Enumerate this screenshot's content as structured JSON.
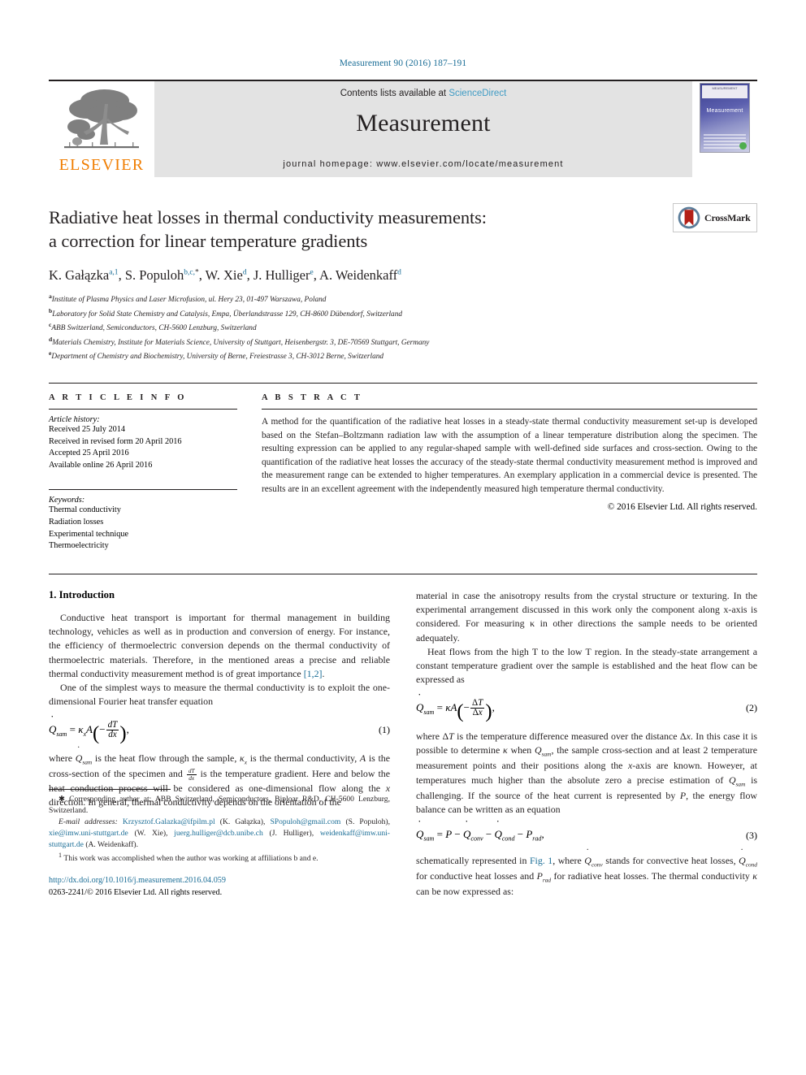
{
  "running_head": "Measurement 90 (2016) 187–191",
  "masthead": {
    "publisher_word": "ELSEVIER",
    "contents_prefix": "Contents lists available at ",
    "contents_link": "ScienceDirect",
    "journal_name": "Measurement",
    "homepage": "journal homepage: www.elsevier.com/locate/measurement",
    "cover_top_text": "MEASUREMENT",
    "cover_title": "Measurement"
  },
  "article": {
    "title_line1": "Radiative heat losses in thermal conductivity measurements:",
    "title_line2": "a correction for linear temperature gradients",
    "crossmark_label": "CrossMark",
    "authors": [
      {
        "name": "K. Gałązka",
        "marks": "a,1"
      },
      {
        "name": "S. Populoh",
        "marks": "b,c,"
      },
      {
        "name": "W. Xie",
        "marks": "d"
      },
      {
        "name": "J. Hulliger",
        "marks": "e"
      },
      {
        "name": "A. Weidenkaff",
        "marks": "d"
      }
    ],
    "affiliations": [
      {
        "mark": "a",
        "text": "Institute of Plasma Physics and Laser Microfusion, ul. Hery 23, 01-497 Warszawa, Poland"
      },
      {
        "mark": "b",
        "text": "Laboratory for Solid State Chemistry and Catalysis, Empa, Überlandstrasse 129, CH-8600 Dübendorf, Switzerland"
      },
      {
        "mark": "c",
        "text": "ABB Switzerland, Semiconductors, CH-5600 Lenzburg, Switzerland"
      },
      {
        "mark": "d",
        "text": "Materials Chemistry, Institute for Materials Science, University of Stuttgart, Heisenbergstr. 3, DE-70569 Stuttgart, Germany"
      },
      {
        "mark": "e",
        "text": "Department of Chemistry and Biochemistry, University of Berne, Freiestrasse 3, CH-3012 Berne, Switzerland"
      }
    ]
  },
  "article_info": {
    "heading": "A R T I C L E  I N F O",
    "history_label": "Article history:",
    "history": [
      "Received 25 July 2014",
      "Received in revised form 20 April 2016",
      "Accepted 25 April 2016",
      "Available online 26 April 2016"
    ],
    "keywords_label": "Keywords:",
    "keywords": [
      "Thermal conductivity",
      "Radiation losses",
      "Experimental technique",
      "Thermoelectricity"
    ]
  },
  "abstract": {
    "heading": "A B S T R A C T",
    "text": "A method for the quantification of the radiative heat losses in a steady-state thermal conductivity measurement set-up is developed based on the Stefan–Boltzmann radiation law with the assumption of a linear temperature distribution along the specimen. The resulting expression can be applied to any regular-shaped sample with well-defined side surfaces and cross-section. Owing to the quantification of the radiative heat losses the accuracy of the steady-state thermal conductivity measurement method is improved and the measurement range can be extended to higher temperatures. An exemplary application in a commercial device is presented. The results are in an excellent agreement with the independently measured high temperature thermal conductivity.",
    "copyright": "© 2016 Elsevier Ltd. All rights reserved."
  },
  "body": {
    "section_title": "1. Introduction",
    "left": {
      "p1_a": "Conductive heat transport is important for thermal management in building technology, vehicles as well as in production and conversion of energy. For instance, the efficiency of thermoelectric conversion depends on the thermal conductivity of thermoelectric materials. Therefore, in the mentioned areas a precise and reliable thermal conductivity measurement method is of great importance ",
      "p1_ref": "[1,2]",
      "p1_b": ".",
      "p2": "One of the simplest ways to measure the thermal conductivity is to exploit the one-dimensional Fourier heat transfer equation",
      "eq1_num": "(1)",
      "p3": "where Q̇sam is the heat flow through the sample, κx is the thermal conductivity, A is the cross-section of the specimen and dT/dx is the temperature gradient. Here and below the heat conduction process will be considered as one-dimensional flow along the x direction. In general, thermal conductivity depends on the orientation of the"
    },
    "right": {
      "p1": "material in case the anisotropy results from the crystal structure or texturing. In the experimental arrangement discussed in this work only the component along x-axis is considered. For measuring κ in other directions the sample needs to be oriented adequately.",
      "p2": "Heat flows from the high T to the low T region. In the steady-state arrangement a constant temperature gradient over the sample is established and the heat flow can be expressed as",
      "eq2_num": "(2)",
      "p3": "where ΔT is the temperature difference measured over the distance Δx. In this case it is possible to determine κ when Q̇sam, the sample cross-section and at least 2 temperature measurement points and their positions along the x-axis are known. However, at temperatures much higher than the absolute zero a precise estimation of Q̇sam is challenging. If the source of the heat current is represented by P, the energy flow balance can be written as an equation",
      "eq3_num": "(3)",
      "p4_a": "schematically represented in ",
      "p4_fig": "Fig. 1",
      "p4_b": ", where Q̇conv stands for convective heat losses, Q̇cond for conductive heat losses and Prad for radiative heat losses. The thermal conductivity κ can be now expressed as:"
    }
  },
  "footnotes": {
    "corresponding": "Corresponding author at: ABB Switzerland, Semiconductors, Biploar R&D, CH-5600 Lenzburg, Switzerland.",
    "email_label": "E-mail addresses:",
    "emails": [
      {
        "address": "Krzysztof.Galazka@ifpilm.pl",
        "who": "(K. Gałązka),"
      },
      {
        "address": "SPopuloh@gmail.com",
        "who": "(S. Populoh),"
      },
      {
        "address": "xie@imw.uni-stuttgart.de",
        "who": "(W. Xie),"
      },
      {
        "address": "juerg.hulliger@dcb.unibe.ch",
        "who": "(J. Hulliger),"
      },
      {
        "address": "weidenkaff@imw.uni-stuttgart.de",
        "who": "(A. Weidenkaff)."
      }
    ],
    "note1_mark": "1",
    "note1": "This work was accomplished when the author was working at affiliations b and e."
  },
  "imprint": {
    "doi": "http://dx.doi.org/10.1016/j.measurement.2016.04.059",
    "issn_line": "0263-2241/© 2016 Elsevier Ltd. All rights reserved."
  },
  "colors": {
    "link": "#1a6d96",
    "elsevier_orange": "#f07d00",
    "masthead_gray": "#e3e3e3",
    "science_direct": "#3f9bc4"
  }
}
